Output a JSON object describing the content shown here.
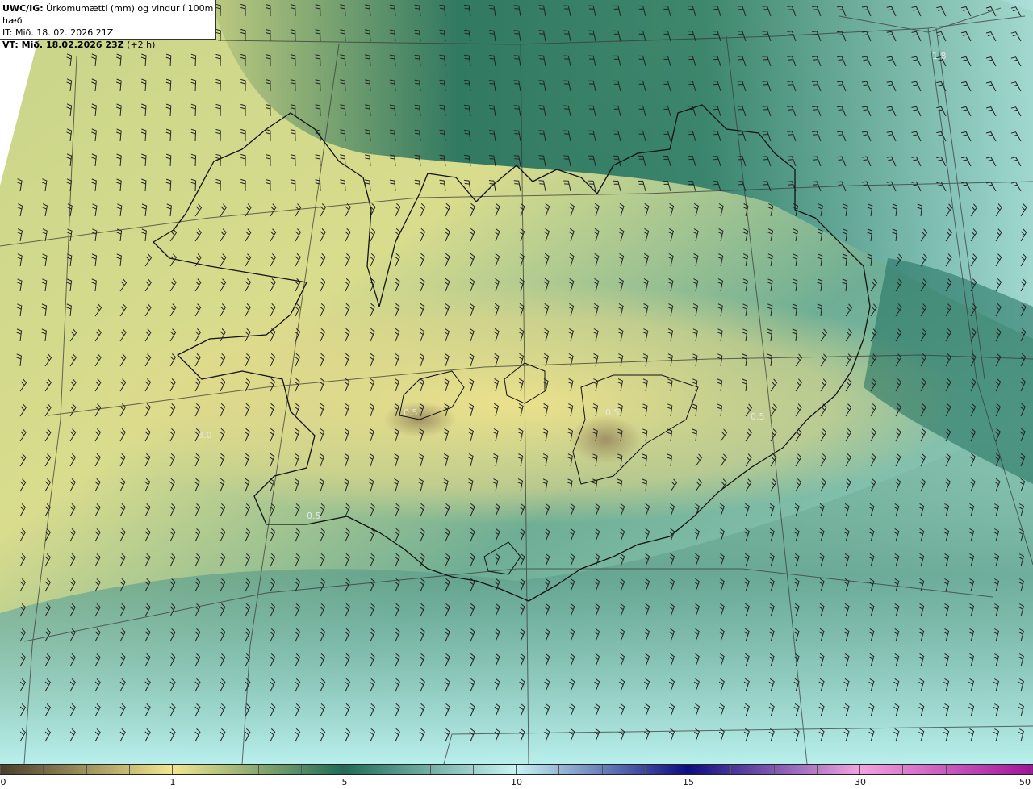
{
  "header": {
    "product": "UWC/IG:",
    "title": " Úrkomumætti (mm) og vindur í 100m hæð",
    "init_prefix": "IT:",
    "init_time": " Mið. 18. 02. 2026 21Z",
    "valid_prefix": "VT:",
    "valid_time": " Mið. 18.02.2026 23Z",
    "valid_offset": " (+2 h)"
  },
  "map": {
    "region": "Iceland",
    "field": "precipitable water",
    "overlay": "wind barbs 100 m",
    "value_labels": [
      "3.0",
      "0.5",
      "0.5",
      "0.5",
      "0.5",
      "1.8"
    ]
  },
  "colorbar": {
    "labels": [
      "0",
      "1",
      "5",
      "10",
      "15",
      "30",
      "50"
    ],
    "colors": {
      "c0": "#4a3d2a",
      "c1": "#f2e78e",
      "c5": "#1f6b55",
      "c10": "#c8f4f4",
      "c15": "#0c0c80",
      "c30": "#f2a3e0",
      "c50": "#a0129a"
    }
  }
}
